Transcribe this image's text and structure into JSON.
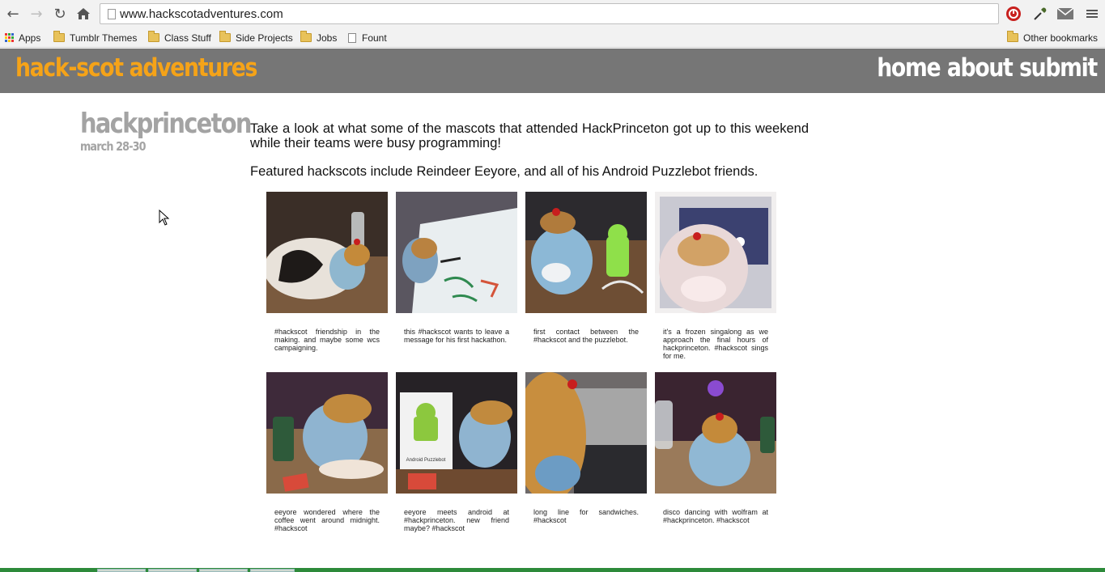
{
  "browser": {
    "url": "www.hackscotadventures.com",
    "bookmarks": [
      "Apps",
      "Tumblr Themes",
      "Class Stuff",
      "Side Projects",
      "Jobs",
      "Fount"
    ],
    "other_bookmarks": "Other bookmarks"
  },
  "site": {
    "logo": "hack-scot adventures",
    "logo_color": "#f5a318",
    "header_color": "#767676",
    "nav": [
      "home",
      "about",
      "submit"
    ]
  },
  "post": {
    "title": "hackprinceton",
    "date": "march 28-30",
    "paragraphs": [
      "Take a look at what some of the mascots that attended HackPrinceton got up to this weekend while their teams were busy programming!",
      "Featured hackscots include Reindeer Eeyore, and all of his Android Puzzlebot friends."
    ],
    "photos": [
      {
        "caption": "#hackscot friendship in the making. and maybe some wcs campaigning."
      },
      {
        "caption": "this #hackscot wants to leave a message for his first hackathon."
      },
      {
        "caption": "first contact between the #hackscot and the puzzlebot."
      },
      {
        "caption": "it's a frozen singalong as we approach the final hours of hackprinceton. #hackscot sings for me."
      },
      {
        "caption": "eeyore wondered where the coffee went around midnight. #hackscot"
      },
      {
        "caption": "eeyore meets android at #hackprinceton. new friend maybe? #hackscot"
      },
      {
        "caption": "long line for sandwiches. #hackscot"
      },
      {
        "caption": "disco dancing with wolfram at #hackprinceton. #hackscot"
      }
    ],
    "photo_labels": {
      "box_label": "Android Puzzlebot"
    }
  }
}
